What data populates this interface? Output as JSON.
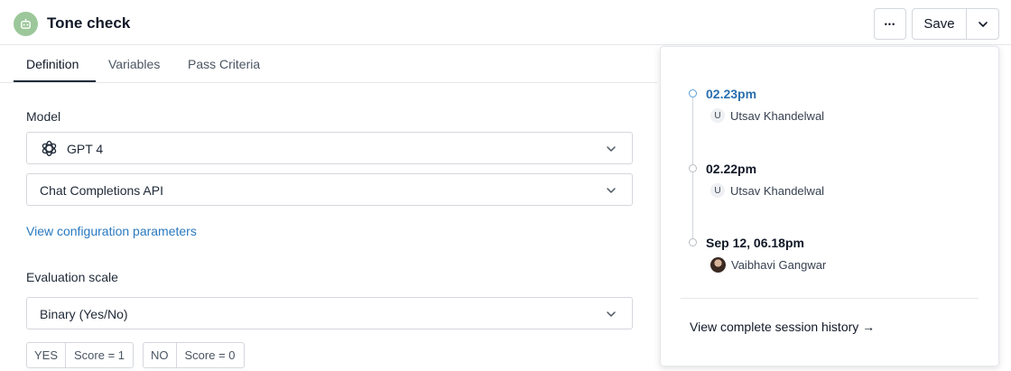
{
  "header": {
    "title": "Tone check",
    "more_label": "•••",
    "save_label": "Save"
  },
  "tabs": [
    {
      "label": "Definition",
      "active": true
    },
    {
      "label": "Variables",
      "active": false
    },
    {
      "label": "Pass Criteria",
      "active": false
    }
  ],
  "model": {
    "label": "Model",
    "model_value": "GPT 4",
    "api_value": "Chat Completions API",
    "config_link": "View configuration parameters"
  },
  "evaluation": {
    "label": "Evaluation scale",
    "value": "Binary (Yes/No)",
    "chips": [
      {
        "key": "YES",
        "value": "Score = 1"
      },
      {
        "key": "NO",
        "value": "Score = 0"
      }
    ]
  },
  "history": {
    "entries": [
      {
        "time": "02.23pm",
        "user": "Utsav Khandelwal",
        "initial": "U",
        "active": true
      },
      {
        "time": "02.22pm",
        "user": "Utsav Khandelwal",
        "initial": "U",
        "active": false
      },
      {
        "time": "Sep 12, 06.18pm",
        "user": "Vaibhavi Gangwar",
        "initial": "",
        "active": false
      }
    ],
    "view_all": "View complete session history →"
  },
  "colors": {
    "accent_link": "#2a79c0",
    "active_time": "#2a6fb0",
    "avatar_bg": "#9cc79a"
  }
}
